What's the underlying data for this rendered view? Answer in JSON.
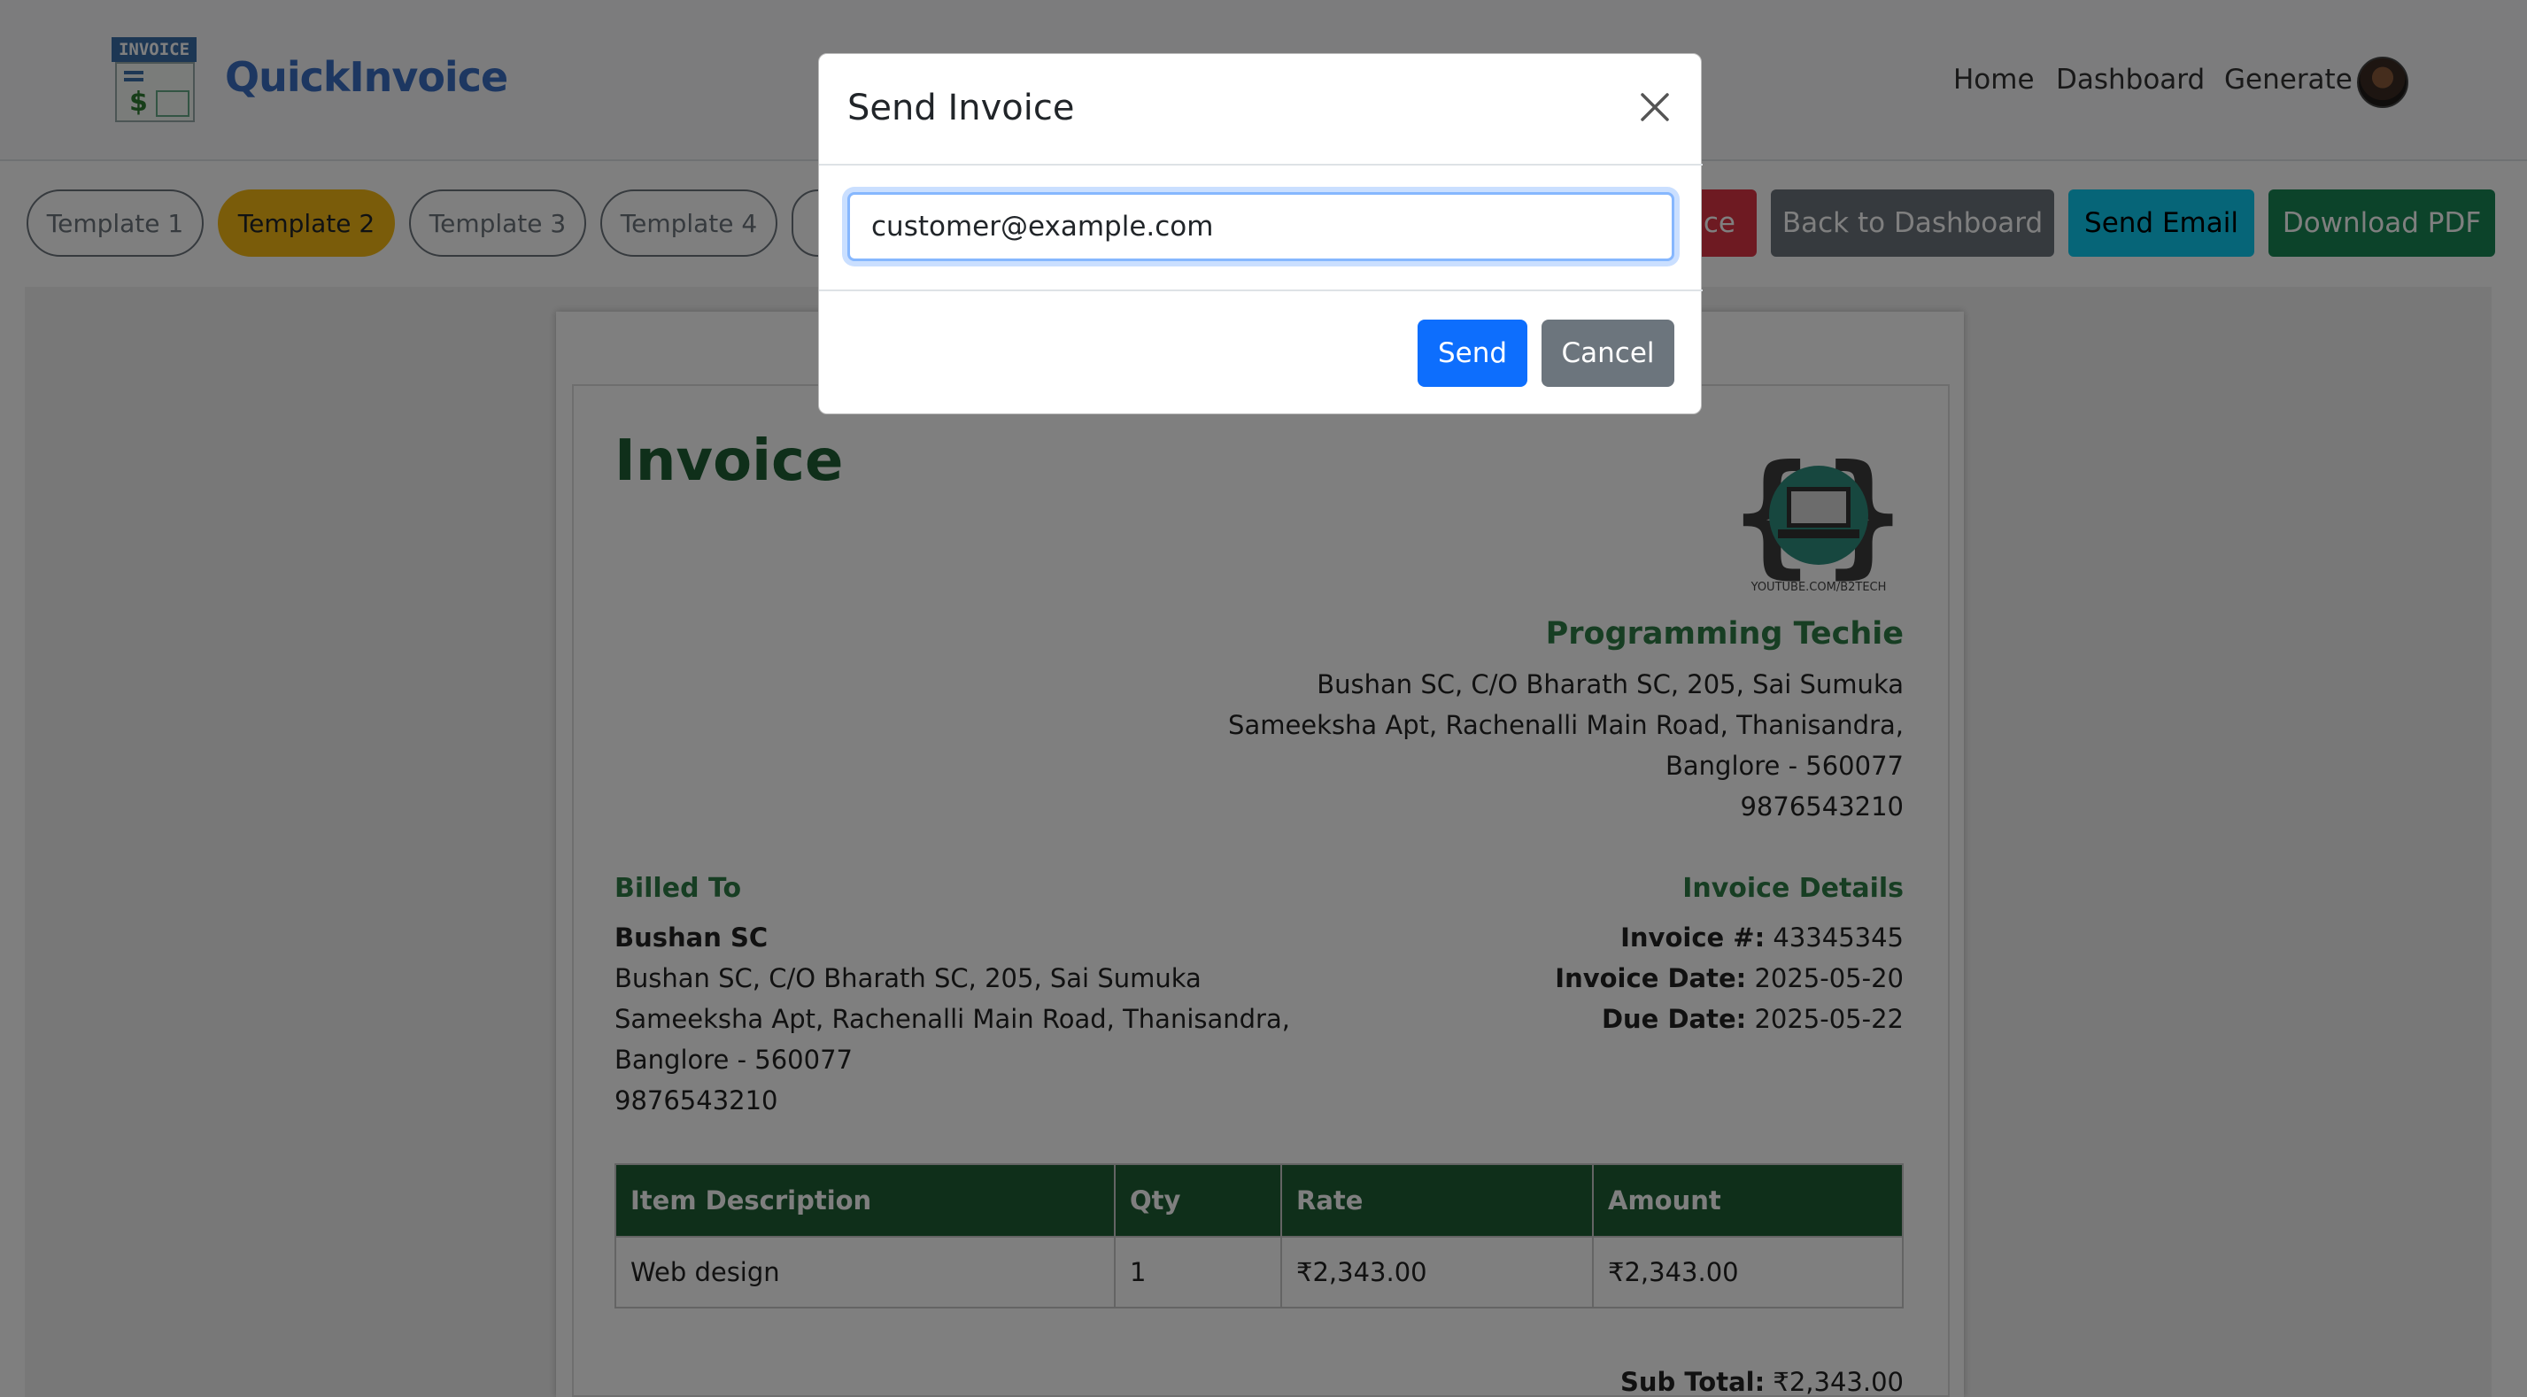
{
  "app": {
    "brand": "QuickInvoice",
    "logo_text": "INVOICE",
    "logo_symbol": "$"
  },
  "nav": {
    "home": "Home",
    "dashboard": "Dashboard",
    "generate": "Generate"
  },
  "templates": [
    {
      "label": "Template 1",
      "active": false
    },
    {
      "label": "Template 2",
      "active": true
    },
    {
      "label": "Template 3",
      "active": false
    },
    {
      "label": "Template 4",
      "active": false
    }
  ],
  "toolbar": {
    "delete_label_partial": "ce",
    "back_label": "Back to Dashboard",
    "send_email_label": "Send Email",
    "download_label": "Download PDF"
  },
  "colors": {
    "active_template": "#f5b914",
    "danger": "#dc3545",
    "secondary": "#6c757d",
    "info": "#0dcaf0",
    "success": "#198754",
    "primary": "#0d6efd",
    "invoice_green": "#1f5f34"
  },
  "invoice": {
    "title": "Invoice",
    "logo_caption": "YOUTUBE.COM/B2TECH",
    "company": {
      "name": "Programming Techie",
      "address_lines": [
        "Bushan SC, C/O Bharath SC, 205, Sai Sumuka",
        "Sameeksha Apt, Rachenalli Main Road, Thanisandra,",
        "Banglore - 560077",
        "9876543210"
      ]
    },
    "billed_to": {
      "heading": "Billed To",
      "name": "Bushan SC",
      "lines": [
        "Bushan SC, C/O Bharath SC, 205, Sai Sumuka",
        "Sameeksha Apt, Rachenalli Main Road, Thanisandra,",
        "Banglore - 560077",
        "9876543210"
      ]
    },
    "details": {
      "heading": "Invoice Details",
      "number_label": "Invoice #:",
      "number": "43345345",
      "date_label": "Invoice Date:",
      "date": "2025-05-20",
      "due_label": "Due Date:",
      "due": "2025-05-22"
    },
    "table": {
      "headers": [
        "Item Description",
        "Qty",
        "Rate",
        "Amount"
      ],
      "rows": [
        [
          "Web design",
          "1",
          "₹2,343.00",
          "₹2,343.00"
        ]
      ]
    },
    "subtotal_label": "Sub Total:",
    "subtotal_value": "₹2,343.00"
  },
  "modal": {
    "title": "Send Invoice",
    "email_value": "customer@example.com",
    "send_label": "Send",
    "cancel_label": "Cancel"
  }
}
